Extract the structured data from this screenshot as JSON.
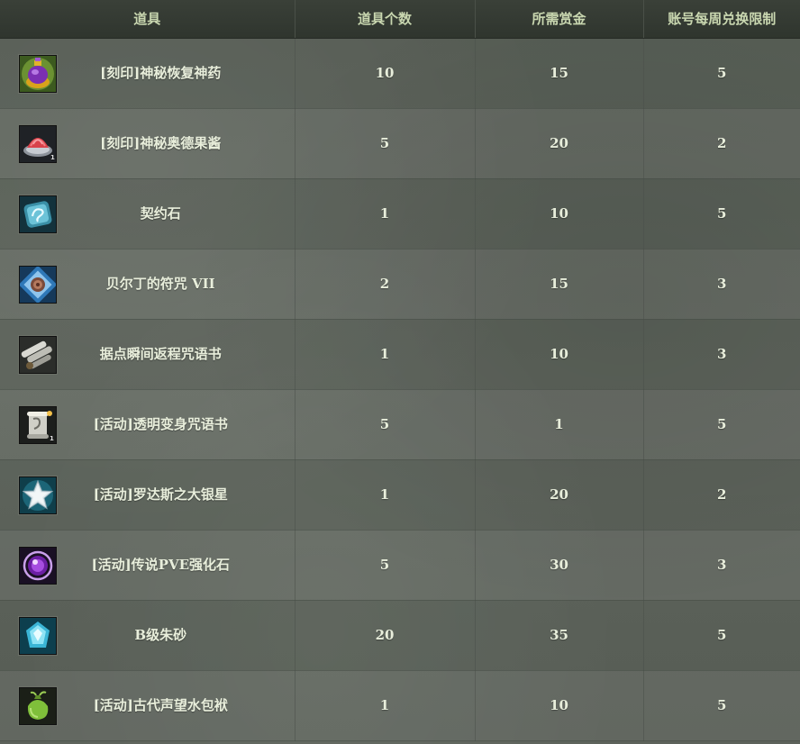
{
  "columns": [
    "道具",
    "道具个数",
    "所需赏金",
    "账号每周兑换限制"
  ],
  "rows": [
    {
      "name": "[刻印]神秘恢复神药",
      "count": "10",
      "bounty": "15",
      "limit": "5",
      "icon": "purple-potion-icon"
    },
    {
      "name": "[刻印]神秘奥德果酱",
      "count": "5",
      "bounty": "20",
      "limit": "2",
      "icon": "red-jelly-dish-icon"
    },
    {
      "name": "契约石",
      "count": "1",
      "bounty": "10",
      "limit": "5",
      "icon": "contract-stone-icon"
    },
    {
      "name": "贝尔丁的符咒 VII",
      "count": "2",
      "bounty": "15",
      "limit": "3",
      "icon": "talisman-icon"
    },
    {
      "name": "据点瞬间返程咒语书",
      "count": "1",
      "bounty": "10",
      "limit": "3",
      "icon": "scroll-bundle-icon"
    },
    {
      "name": "[活动]透明变身咒语书",
      "count": "5",
      "bounty": "1",
      "limit": "5",
      "icon": "transform-scroll-icon"
    },
    {
      "name": "[活动]罗达斯之大银星",
      "count": "1",
      "bounty": "20",
      "limit": "2",
      "icon": "silver-star-icon"
    },
    {
      "name": "[活动]传说PVE强化石",
      "count": "5",
      "bounty": "30",
      "limit": "3",
      "icon": "purple-orb-icon"
    },
    {
      "name": "B级朱砂",
      "count": "20",
      "bounty": "35",
      "limit": "5",
      "icon": "cyan-crystal-icon"
    },
    {
      "name": "[活动]古代声望水包袱",
      "count": "1",
      "bounty": "10",
      "limit": "5",
      "icon": "green-pouch-icon"
    }
  ]
}
